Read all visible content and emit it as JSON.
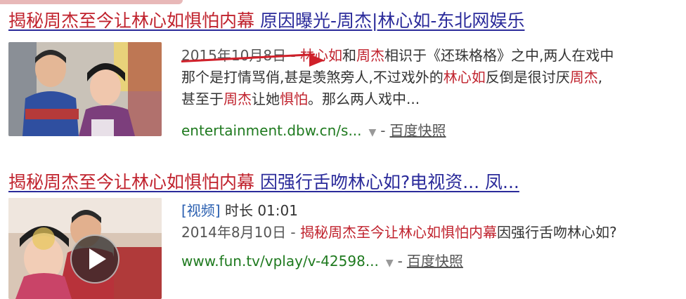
{
  "results": [
    {
      "title_hl": "揭秘周杰至今让林心如惧怕内幕",
      "title_rest": " 原因曝光-周杰|林心如-东北网娱乐",
      "date": "2015年10月8日",
      "snippet_l1": [
        "林心如",
        "和",
        "周杰",
        "相识于《还珠格格》之中,两人在戏中"
      ],
      "snippet_l2": [
        "那个是打情骂俏,甚是羡煞旁人,不过戏外的",
        "林心如",
        "反倒是很讨厌",
        "周杰",
        ","
      ],
      "snippet_l3": [
        "甚至于",
        "周杰",
        "让她",
        "惧怕",
        "。那么两人戏中..."
      ],
      "url": "entertainment.dbw.cn/s...",
      "cache_label": "百度快照"
    },
    {
      "title_hl": "揭秘周杰至今让林心如惧怕内幕",
      "title_rest": " 因强行舌吻林心如?电视资... 凤...",
      "video_tag": "[视频]",
      "duration": "时长 01:01",
      "date": "2014年8月10日",
      "snippet_hl": "揭秘周杰至今让林心如惧怕内幕",
      "snippet_rest": "因强行舌吻林心如?",
      "url": "www.fun.tv/vplay/v-42598...",
      "cache_label": "百度快照"
    }
  ],
  "icons": [
    "caret-down-icon",
    "play-icon"
  ],
  "colors": {
    "title": "#2a2a9a",
    "highlight": "#c0222d",
    "url": "#1f7a1f",
    "arrow": "#d0202a"
  }
}
